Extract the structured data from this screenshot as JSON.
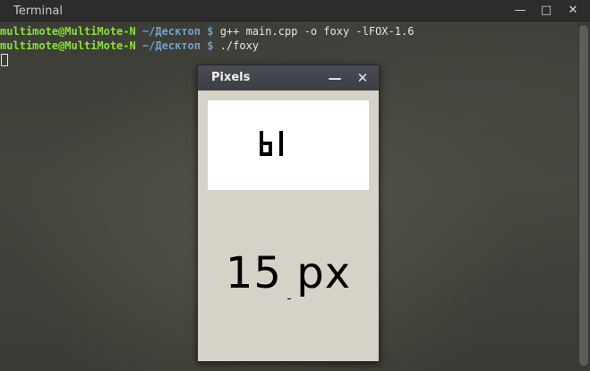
{
  "terminal": {
    "title": "Terminal",
    "lines": [
      {
        "user": "multimote@MultiMote-N",
        "path": "~/Десктоп",
        "dollar": "$",
        "command": "g++ main.cpp -o foxy -lFOX-1.6"
      },
      {
        "user": "multimote@MultiMote-N",
        "path": "~/Десктоп",
        "dollar": "$",
        "command": "./foxy"
      }
    ],
    "buttons": {
      "minimize": "—",
      "maximize": "□",
      "close": "✕"
    }
  },
  "pixels_window": {
    "title": "Pixels",
    "buttons": {
      "minimize": "—",
      "close": "✕"
    },
    "preview_glyph": "ы",
    "size_label": "15 px"
  },
  "colors": {
    "prompt_user": "#8ae234",
    "prompt_path": "#729fcf",
    "pixels_bg": "#d6d2c8"
  }
}
